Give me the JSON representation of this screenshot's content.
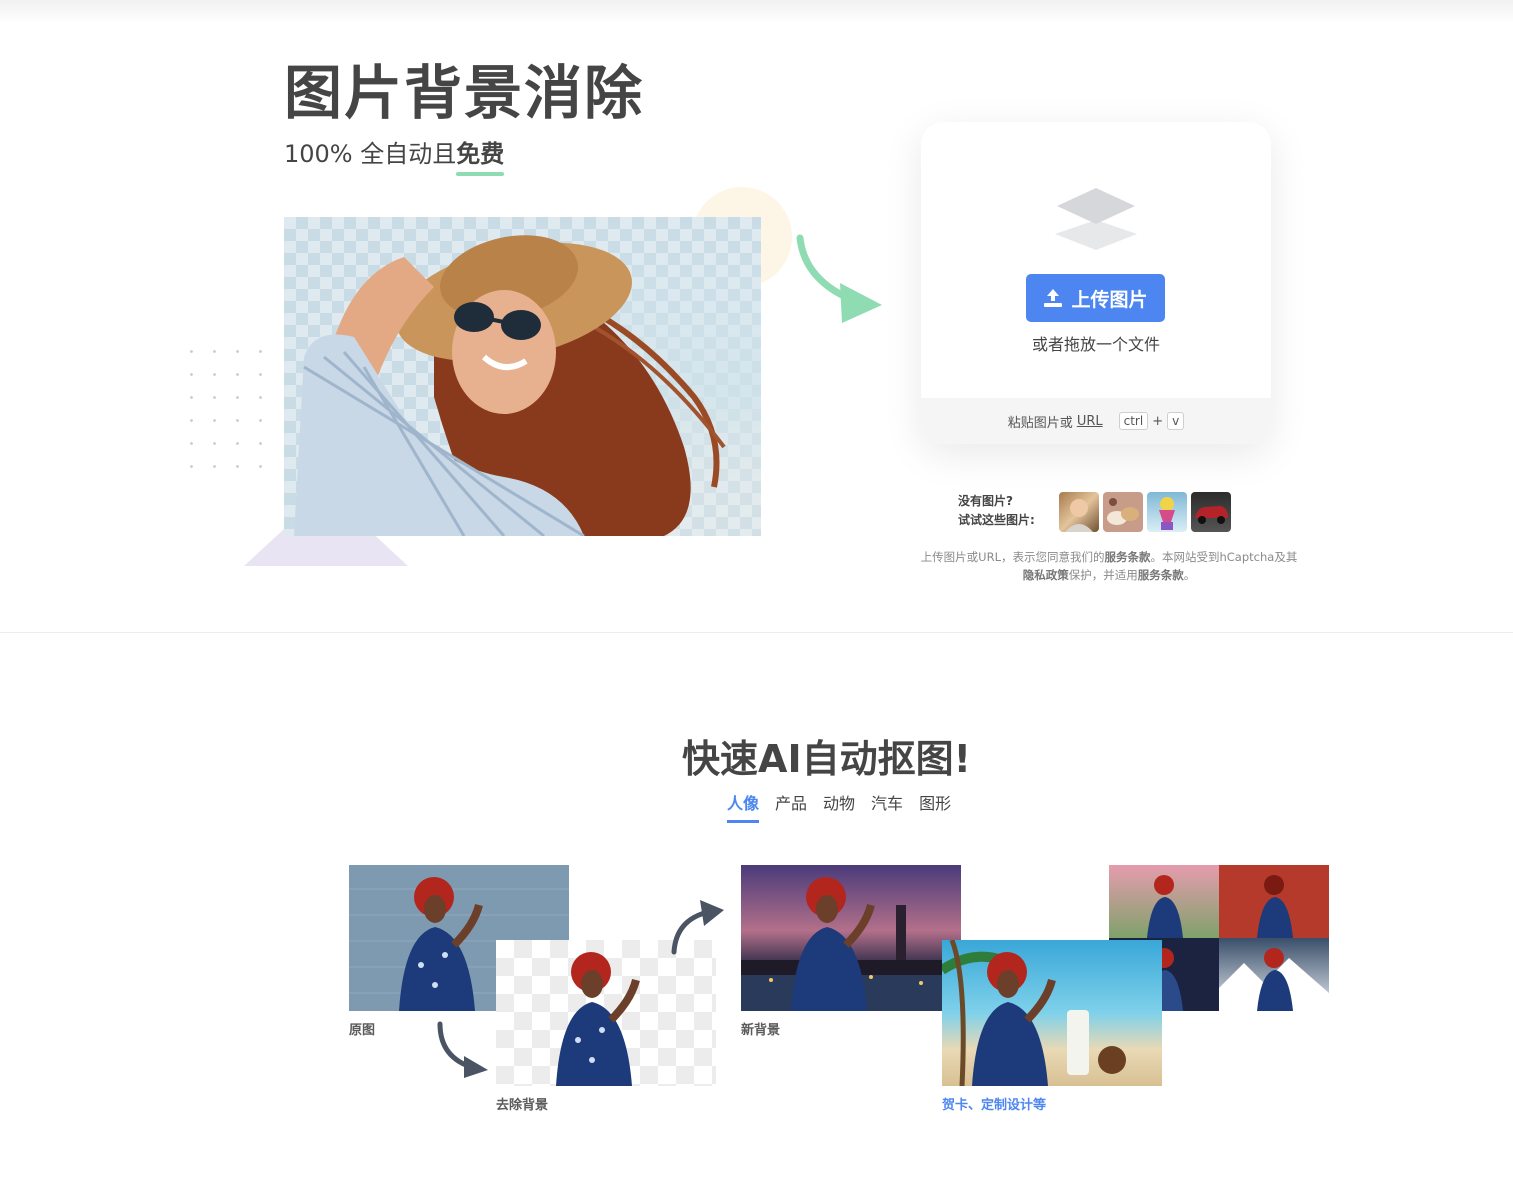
{
  "hero": {
    "title": "图片背景消除",
    "subtitle_prefix": "100% 全自动且",
    "subtitle_highlight": "免费"
  },
  "upload": {
    "button_label": "上传图片",
    "drop_text": "或者拖放一个文件",
    "paste_prefix": "粘贴图片或",
    "paste_url": "URL",
    "key_ctrl": "ctrl",
    "key_plus": "+",
    "key_v": "v"
  },
  "samples": {
    "label_line1": "没有图片?",
    "label_line2": "试试这些图片:"
  },
  "legal": {
    "p1": "上传图片或URL，表示您同意我们的",
    "terms1": "服务条款",
    "p2": "。本网站受到hCaptcha及其",
    "privacy": "隐私政策",
    "p3": "保护，并适用",
    "terms2": "服务条款",
    "p4": "。"
  },
  "section2": {
    "title": "快速AI自动抠图!",
    "tabs": [
      "人像",
      "产品",
      "动物",
      "汽车",
      "图形"
    ],
    "active_tab": "人像",
    "captions": {
      "original": "原图",
      "removed": "去除背景",
      "new_bg": "新背景",
      "designs": "贺卡、定制设计等"
    }
  },
  "colors": {
    "accent": "#4d86f0",
    "green_accent": "#8fdcb3",
    "text": "#454545"
  }
}
